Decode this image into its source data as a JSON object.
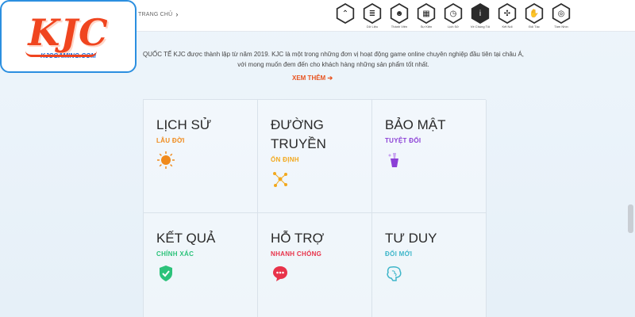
{
  "logo": {
    "text": "KJC",
    "sub": "KJCGAMING.COM"
  },
  "breadcrumb": {
    "label": "TRANG CHỦ"
  },
  "nav": [
    {
      "name": "nav-home",
      "icon": "chevrons-up-icon",
      "glyph": "⌃",
      "label": ""
    },
    {
      "name": "nav-du-lieu",
      "icon": "database-icon",
      "glyph": "≣",
      "label": "Dữ Liệu"
    },
    {
      "name": "nav-thanh-vien",
      "icon": "users-icon",
      "glyph": "☻",
      "label": "Thành Viên"
    },
    {
      "name": "nav-su-kien",
      "icon": "calendar-icon",
      "glyph": "▦",
      "label": "Sự Kiện"
    },
    {
      "name": "nav-lich-su",
      "icon": "clock-icon",
      "glyph": "◷",
      "label": "Lịch Sử"
    },
    {
      "name": "nav-ve-chung-toi",
      "icon": "info-icon",
      "glyph": "i",
      "label": "Về Chúng Tôi",
      "active": true
    },
    {
      "name": "nav-ket-noi",
      "icon": "network-icon",
      "glyph": "✣",
      "label": "Kết Nối"
    },
    {
      "name": "nav-doi-tac",
      "icon": "handshake-icon",
      "glyph": "✋",
      "label": "Đối Tác"
    },
    {
      "name": "nav-tam-nhin",
      "icon": "target-icon",
      "glyph": "◎",
      "label": "Tầm Nhìn"
    }
  ],
  "intro": {
    "line1": "QUỐC TẾ KJC được thành lập từ năm 2019. KJC là một trong những đơn vị hoạt động game online chuyên nghiệp đầu tiên tại châu Á,",
    "line2": "với mong muốn đem đến cho khách hàng những sản phẩm tốt nhất.",
    "see_more": "XEM THÊM ➔"
  },
  "cards": [
    {
      "title": "LỊCH SỬ",
      "sub": "LÂU ĐỜI",
      "color": "#f08a1c",
      "icon": "sun-icon"
    },
    {
      "title": "ĐƯỜNG TRUYỀN",
      "sub": "ỔN ĐỊNH",
      "color": "#f2a81d",
      "icon": "network-nodes-icon"
    },
    {
      "title": "BẢO MẬT",
      "sub": "TUYỆT ĐỐI",
      "color": "#8b3fd6",
      "icon": "lock-cup-icon"
    },
    {
      "title": "KẾT QUẢ",
      "sub": "CHÍNH XÁC",
      "color": "#2cc27a",
      "icon": "shield-check-icon"
    },
    {
      "title": "HỖ TRỢ",
      "sub": "NHANH CHÓNG",
      "color": "#e8334a",
      "icon": "chat-bubble-icon"
    },
    {
      "title": "TƯ DUY",
      "sub": "ĐỔI MỚI",
      "color": "#3fb6c9",
      "icon": "brain-icon"
    }
  ]
}
